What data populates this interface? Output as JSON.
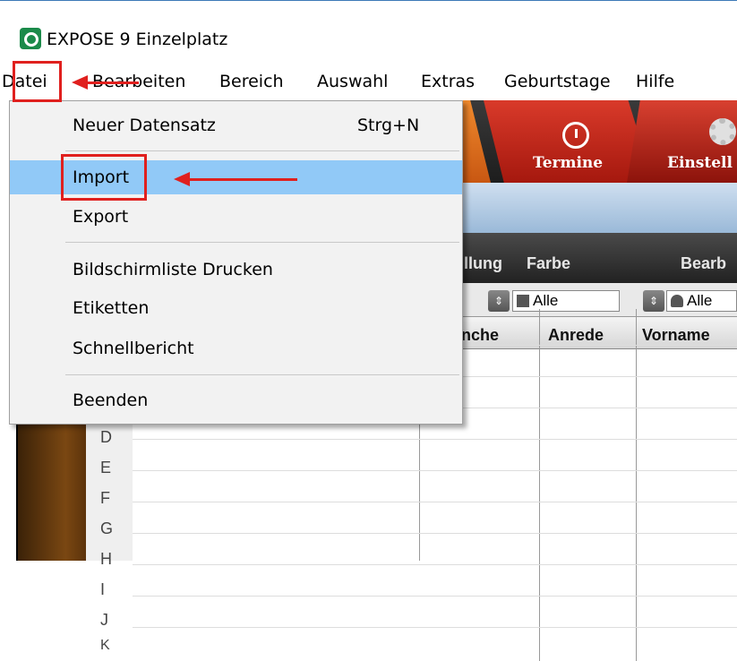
{
  "window": {
    "title": "EXPOSE 9 Einzelplatz"
  },
  "menubar": {
    "items": [
      "Datei",
      "Bearbeiten",
      "Bereich",
      "Auswahl",
      "Extras",
      "Geburtstage",
      "Hilfe"
    ]
  },
  "dropdown": {
    "new_record": {
      "label": "Neuer Datensatz",
      "shortcut": "Strg+N"
    },
    "import": "Import",
    "export": "Export",
    "print_list": "Bildschirmliste Drucken",
    "labels": "Etiketten",
    "quick_report": "Schnellbericht",
    "quit": "Beenden"
  },
  "toolbar": {
    "tab_termine": "Termine",
    "tab_einstellungen": "Einstell"
  },
  "filter_bar": {
    "col_a": "llung",
    "col_b": "Farbe",
    "col_c": "Bearb"
  },
  "filters": {
    "farbe_value": "Alle",
    "anrede_value": "Alle"
  },
  "table": {
    "headers": [
      "nche",
      "Anrede",
      "Vorname"
    ],
    "letters": [
      "D",
      "E",
      "F",
      "G",
      "H",
      "I",
      "J",
      "K"
    ]
  },
  "colors": {
    "highlight": "#91c9f7",
    "callout": "#e0201e",
    "accent_red": "#c8281a",
    "brown": "#7a4712"
  }
}
